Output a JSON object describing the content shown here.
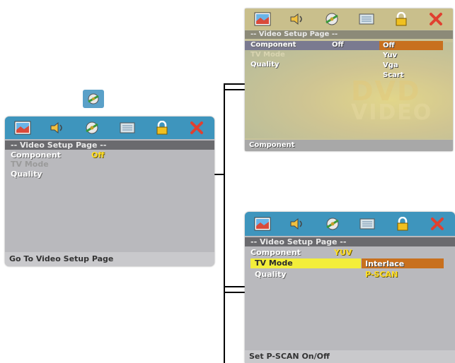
{
  "colors": {
    "icon_bar": "#3e95bd",
    "title_bar": "#6a6a6e",
    "panel_bg": "#b9b9bd",
    "highlight_yellow": "#f3ee3a",
    "highlight_orange": "#c8701e",
    "value_yellow": "#ffde2a"
  },
  "icons": [
    "picture-icon",
    "speaker-icon",
    "video-reel-icon",
    "preferences-icon",
    "lock-icon",
    "close-icon"
  ],
  "panel_left": {
    "title": "-- Video Setup Page --",
    "rows": [
      {
        "label": "Component",
        "value": "Off"
      },
      {
        "label": "TV Mode",
        "value": ""
      },
      {
        "label": "Quality",
        "value": ""
      }
    ],
    "status": "Go To Video Setup Page"
  },
  "panel_top": {
    "title": "-- Video Setup Page --",
    "rows": [
      {
        "label": "Component",
        "value": "Off"
      },
      {
        "label": "TV Mode",
        "value": ""
      },
      {
        "label": "Quality",
        "value": ""
      }
    ],
    "options": [
      "Off",
      "Yuv",
      "Vga",
      "Scart"
    ],
    "status": "Component"
  },
  "panel_bottom": {
    "title": "-- Video Setup Page --",
    "rows": [
      {
        "label": "Component",
        "value": "YUV"
      },
      {
        "label": "TV Mode",
        "value": ""
      },
      {
        "label": "Quality",
        "value": ""
      }
    ],
    "options": [
      "Interlace",
      "P-SCAN"
    ],
    "status": "Set P-SCAN On/Off"
  }
}
